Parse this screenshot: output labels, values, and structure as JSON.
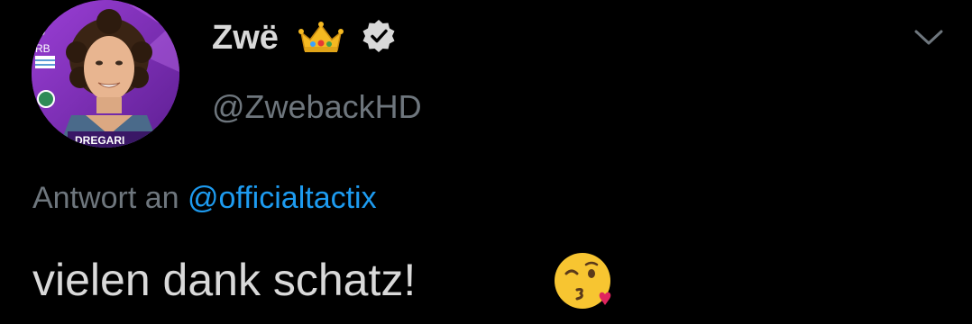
{
  "tweet": {
    "display_name": "Zwë",
    "name_emoji": "crown-icon",
    "verified_badge": "verified-icon",
    "handle": "@ZwebackHD",
    "menu_icon": "chevron-down-icon",
    "reply_prefix": "Antwort an",
    "reply_mention": "@officialtactix",
    "text": "vielen dank schatz!",
    "text_emoji": "face-blowing-a-kiss-icon",
    "avatar_text": {
      "top_left_line1": "J",
      "top_left_line2": "RB",
      "bottom_banner": "DREGARI"
    }
  },
  "colors": {
    "background": "#000000",
    "primary_text": "#d9d9d9",
    "secondary_text": "#6e767d",
    "mention": "#1d9bf0",
    "avatar_purple": "#7b2fb5"
  }
}
